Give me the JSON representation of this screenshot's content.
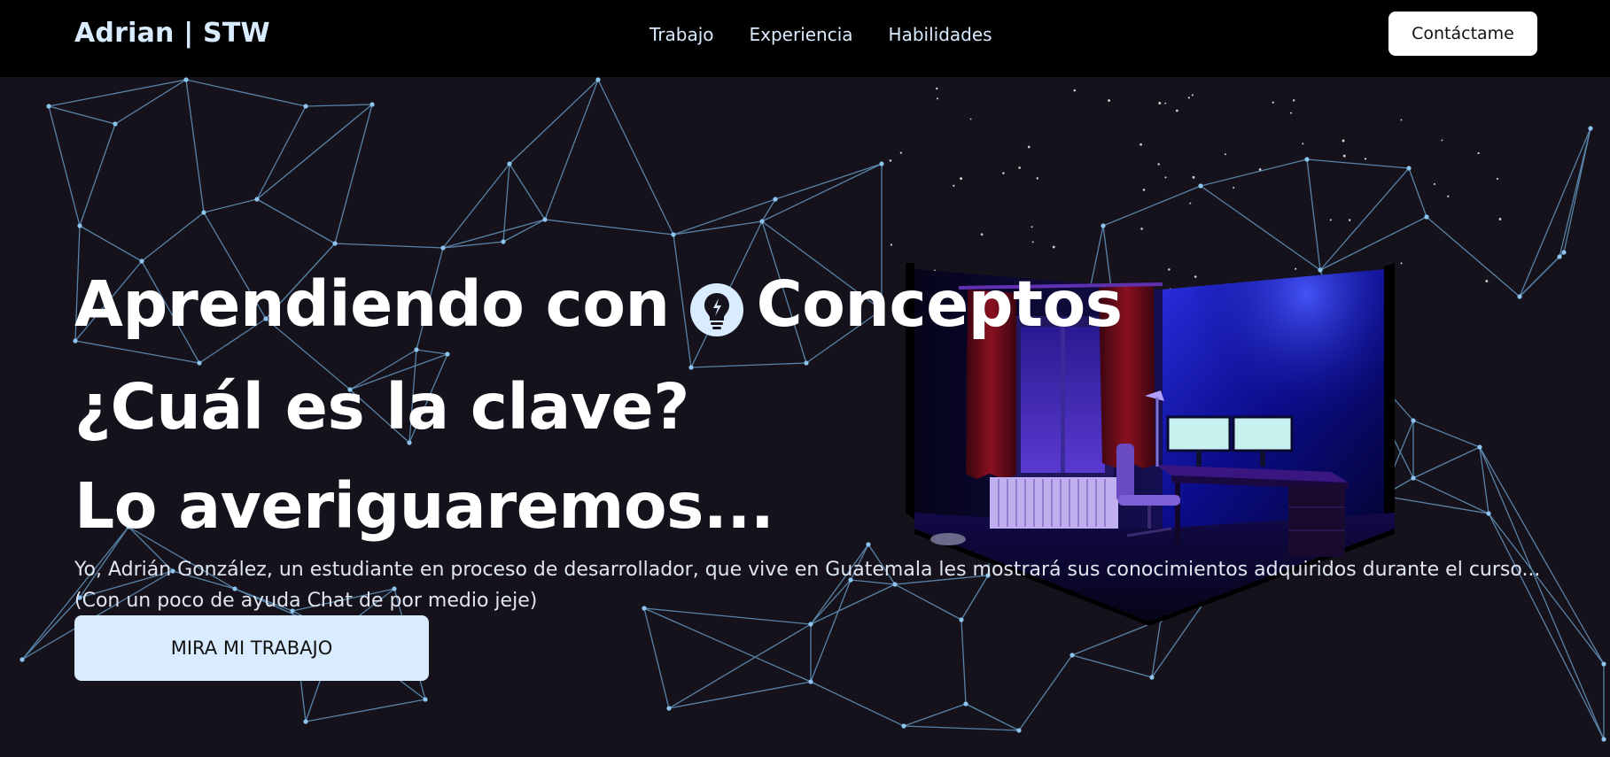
{
  "header": {
    "logo": "Adrian | STW",
    "nav": [
      "Trabajo",
      "Experiencia",
      "Habilidades"
    ],
    "contact_label": "Contáctame"
  },
  "hero": {
    "line1_before": "Aprendiendo con",
    "line1_icon": "lightbulb-icon",
    "line1_after": "Conceptos",
    "line2": "¿Cuál es la clave?",
    "line3": "Lo averiguaremos...",
    "intro": "Yo, Adrián González, un estudiante en proceso de desarrollador, que vive en Guatemala les mostrará sus conocimientos adquiridos durante el curso... (Con un poco de ayuda Chat de por medio jeje)",
    "cta_label": "MIRA MI TRABAJO"
  },
  "colors": {
    "background": "#16121c",
    "navbar": "#000000",
    "accent": "#d9ecff",
    "network_line": "#6fa9d6"
  }
}
